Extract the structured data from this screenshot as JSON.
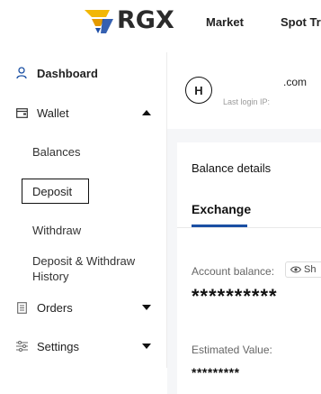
{
  "header": {
    "logo_text": "RGX",
    "nav": [
      "Market",
      "Spot Tr"
    ]
  },
  "sidebar": {
    "dashboard": "Dashboard",
    "wallet": "Wallet",
    "wallet_sub": [
      "Balances",
      "Deposit",
      "Withdraw",
      "Deposit & Withdraw History"
    ],
    "orders": "Orders",
    "settings": "Settings"
  },
  "profile": {
    "avatar_initial": "H",
    "email_suffix": ".com",
    "last_login_label": "Last login IP:"
  },
  "balance": {
    "title": "Balance details",
    "tab": "Exchange",
    "account_label": "Account balance:",
    "show_label": "Sh",
    "account_value": "**********",
    "estimated_label": "Estimated Value:",
    "estimated_value": "*********"
  },
  "colors": {
    "accent_blue": "#1a4fa3",
    "logo_gold": "#f2b705",
    "logo_blue": "#1f4fa8"
  }
}
